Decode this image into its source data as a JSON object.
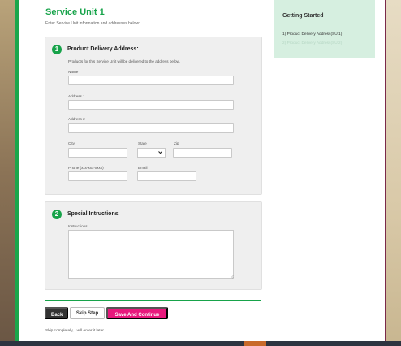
{
  "page": {
    "title": "Service Unit 1",
    "subtitle": "Enter Service Unit information and addresses below:"
  },
  "section1": {
    "number": "1",
    "title": "Product Delivery Address:",
    "description": "Products for this Service Unit will be delivered to the address below.",
    "fields": {
      "name_label": "Name",
      "address1_label": "Address 1",
      "address2_label": "Address 2",
      "city_label": "City",
      "state_label": "State",
      "zip_label": "Zip",
      "phone_label": "Phone (xxx-xxx-xxxx)",
      "email_label": "Email"
    }
  },
  "section2": {
    "number": "2",
    "title": "Special Intructions",
    "instructions_label": "Instructions"
  },
  "buttons": {
    "back": "Back",
    "skip": "Skip Step",
    "save": "Save And Continue"
  },
  "skip_note": "Skip completely, I will enter it later.",
  "sidebar": {
    "title": "Getting Started",
    "items": [
      "1) Product Delivery Address(SU 1)",
      "2) Product Delivery Address(SU 2)"
    ]
  },
  "colors": {
    "accent_green": "#17a34a",
    "save_pink": "#e8197d",
    "sidebar_bg": "#d6efe0"
  }
}
